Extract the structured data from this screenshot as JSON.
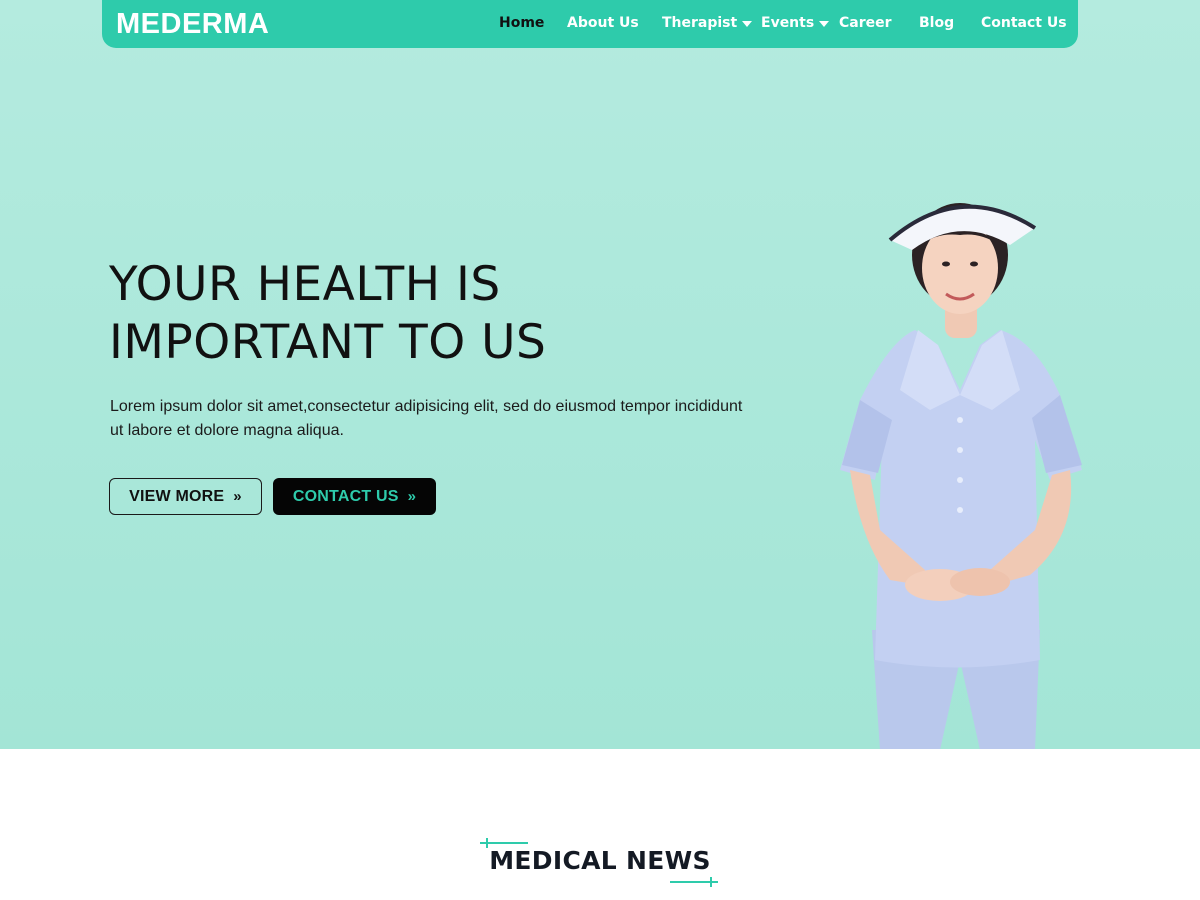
{
  "brand": {
    "logo": "MEDERMA",
    "accent_color": "#2ecbab"
  },
  "nav": {
    "items": [
      {
        "label": "Home",
        "active": true,
        "dropdown": false
      },
      {
        "label": "About Us",
        "active": false,
        "dropdown": false
      },
      {
        "label": "Therapist",
        "active": false,
        "dropdown": true
      },
      {
        "label": "Events",
        "active": false,
        "dropdown": true
      },
      {
        "label": "Career",
        "active": false,
        "dropdown": false
      },
      {
        "label": "Blog",
        "active": false,
        "dropdown": false
      },
      {
        "label": "Contact Us",
        "active": false,
        "dropdown": false
      }
    ]
  },
  "hero": {
    "title_line1": "YOUR HEALTH IS",
    "title_line2": "IMPORTANT TO US",
    "description": "Lorem ipsum dolor sit amet,consectetur adipisicing elit, sed do eiusmod tempor incididunt ut labore et dolore magna aliqua.",
    "view_more_label": "VIEW MORE",
    "contact_label": "CONTACT US",
    "chevron_icon": "double-chevron-right-icon",
    "background_color": "#a9e7d9"
  },
  "news": {
    "title": "MEDICAL NEWS"
  }
}
